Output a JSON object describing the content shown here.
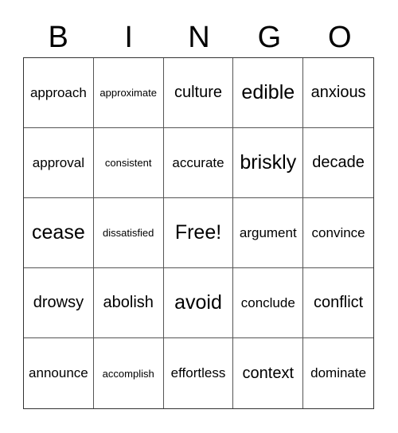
{
  "header": [
    "B",
    "I",
    "N",
    "G",
    "O"
  ],
  "cells": [
    {
      "text": "approach",
      "size": "m"
    },
    {
      "text": "approximate",
      "size": "s"
    },
    {
      "text": "culture",
      "size": "l"
    },
    {
      "text": "edible",
      "size": "xl"
    },
    {
      "text": "anxious",
      "size": "l"
    },
    {
      "text": "approval",
      "size": "m"
    },
    {
      "text": "consistent",
      "size": "s"
    },
    {
      "text": "accurate",
      "size": "m"
    },
    {
      "text": "briskly",
      "size": "xl"
    },
    {
      "text": "decade",
      "size": "l"
    },
    {
      "text": "cease",
      "size": "xl"
    },
    {
      "text": "dissatisfied",
      "size": "s"
    },
    {
      "text": "Free!",
      "size": "xl"
    },
    {
      "text": "argument",
      "size": "m"
    },
    {
      "text": "convince",
      "size": "m"
    },
    {
      "text": "drowsy",
      "size": "l"
    },
    {
      "text": "abolish",
      "size": "l"
    },
    {
      "text": "avoid",
      "size": "xl"
    },
    {
      "text": "conclude",
      "size": "m"
    },
    {
      "text": "conflict",
      "size": "l"
    },
    {
      "text": "announce",
      "size": "m"
    },
    {
      "text": "accomplish",
      "size": "s"
    },
    {
      "text": "effortless",
      "size": "m"
    },
    {
      "text": "context",
      "size": "l"
    },
    {
      "text": "dominate",
      "size": "m"
    }
  ]
}
